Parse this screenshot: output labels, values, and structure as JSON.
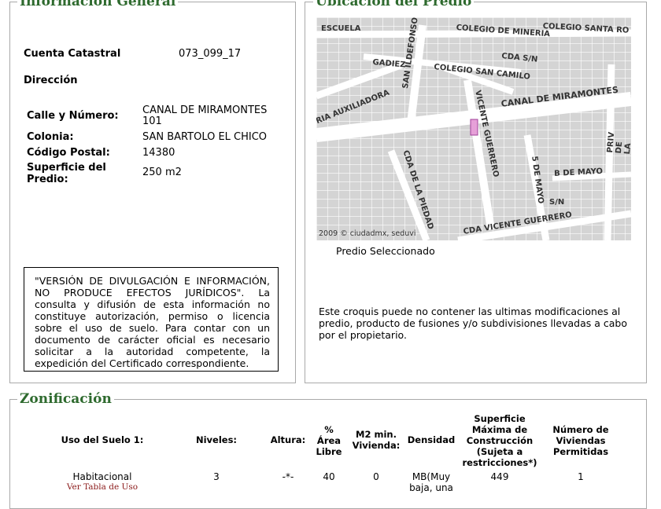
{
  "general": {
    "legend": "Información General",
    "cuenta_label": "Cuenta Catastral",
    "cuenta_value": "073_099_17",
    "direccion_label": "Dirección",
    "calle_label": "Calle y Número:",
    "calle_value_1": "CANAL DE MIRAMONTES",
    "calle_value_2": "101",
    "colonia_label": "Colonia:",
    "colonia_value": "SAN BARTOLO EL CHICO",
    "cp_label": "Código Postal:",
    "cp_value": "14380",
    "superficie_label_1": "Superficie del",
    "superficie_label_2": "Predio:",
    "superficie_value": "250 m2",
    "disclaimer": "\"VERSIÓN DE DIVULGACIÓN E INFORMACIÓN, NO PRODUCE EFECTOS JURÍDICOS\". La consulta y difusión de esta información no constituye autorización, permiso o licencia sobre el uso de suelo. Para contar con un documento de carácter oficial es necesario solicitar a la autoridad competente, la expedición del Certificado correspondiente."
  },
  "ubicacion": {
    "legend": "Ubicación del Predio",
    "map_labels": {
      "escuela": "ESCUELA",
      "colegio_mineria": "COLEGIO DE MINERIA",
      "colegio_santa": "COLEGIO SANTA RO",
      "san_ildefonso": "SAN ILDEFONSO",
      "gadiez": "GADIEZ",
      "colegio_san_camilo": "COLEGIO SAN CAMILO",
      "cda_sn": "CDA S/N",
      "auxiliadora": "RIA AUXILIADORA",
      "canal": "CANAL DE MIRAMONTES",
      "priv_rosa": "PRIV DE LA ROSA",
      "vicente": "VICENTE GUERRERO",
      "cda_piedad": "CDA DE LA PIEDAD",
      "cinco_mayo": "5 DE MAYO",
      "b_mayo": "B DE MAYO",
      "sn": "S/N",
      "cda_vicente": "CDA VICENTE GUERRERO",
      "copyright": "2009 © ciudadmx, seduvi"
    },
    "caption": "Predio Seleccionado",
    "note": "Este croquis puede no contener las ultimas modificaciones al predio, producto de fusiones y/o subdivisiones llevadas a cabo por el propietario."
  },
  "zonificacion": {
    "legend": "Zonificación",
    "headers": {
      "uso": "Uso del Suelo 1:",
      "niveles": "Niveles:",
      "altura": "Altura:",
      "area_1": "%",
      "area_2": "Área",
      "area_3": "Libre",
      "m2_1": "M2 min.",
      "m2_2": "Vivienda:",
      "densidad": "Densidad",
      "sup_1": "Superficie",
      "sup_2": "Máxima de",
      "sup_3": "Construcción",
      "sup_4": "(Sujeta a",
      "sup_5": "restricciones*)",
      "viv_1": "Número de",
      "viv_2": "Viviendas",
      "viv_3": "Permitidas"
    },
    "row": {
      "uso": "Habitacional",
      "uso_link": "Ver Tabla de Uso",
      "niveles": "3",
      "altura": "-*-",
      "area": "40",
      "m2": "0",
      "densidad_1": "MB(Muy",
      "densidad_2": "baja, una",
      "superficie": "449",
      "viviendas": "1"
    }
  },
  "colors": {
    "legend_green": "#2e6a2e",
    "border": "#a9a9a9",
    "link": "#8b1a1a",
    "predio_highlight": "#e6a0d8"
  }
}
